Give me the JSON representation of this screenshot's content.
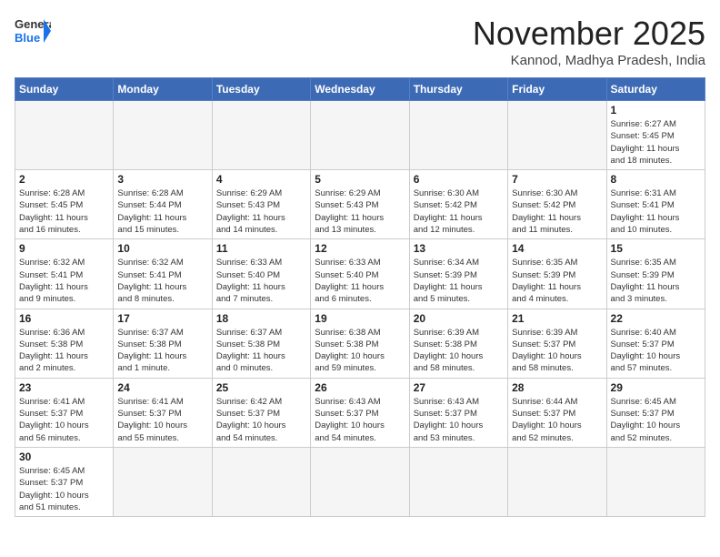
{
  "header": {
    "logo_general": "General",
    "logo_blue": "Blue",
    "month_title": "November 2025",
    "location": "Kannod, Madhya Pradesh, India"
  },
  "weekdays": [
    "Sunday",
    "Monday",
    "Tuesday",
    "Wednesday",
    "Thursday",
    "Friday",
    "Saturday"
  ],
  "weeks": [
    [
      {
        "day": "",
        "info": ""
      },
      {
        "day": "",
        "info": ""
      },
      {
        "day": "",
        "info": ""
      },
      {
        "day": "",
        "info": ""
      },
      {
        "day": "",
        "info": ""
      },
      {
        "day": "",
        "info": ""
      },
      {
        "day": "1",
        "info": "Sunrise: 6:27 AM\nSunset: 5:45 PM\nDaylight: 11 hours\nand 18 minutes."
      }
    ],
    [
      {
        "day": "2",
        "info": "Sunrise: 6:28 AM\nSunset: 5:45 PM\nDaylight: 11 hours\nand 16 minutes."
      },
      {
        "day": "3",
        "info": "Sunrise: 6:28 AM\nSunset: 5:44 PM\nDaylight: 11 hours\nand 15 minutes."
      },
      {
        "day": "4",
        "info": "Sunrise: 6:29 AM\nSunset: 5:43 PM\nDaylight: 11 hours\nand 14 minutes."
      },
      {
        "day": "5",
        "info": "Sunrise: 6:29 AM\nSunset: 5:43 PM\nDaylight: 11 hours\nand 13 minutes."
      },
      {
        "day": "6",
        "info": "Sunrise: 6:30 AM\nSunset: 5:42 PM\nDaylight: 11 hours\nand 12 minutes."
      },
      {
        "day": "7",
        "info": "Sunrise: 6:30 AM\nSunset: 5:42 PM\nDaylight: 11 hours\nand 11 minutes."
      },
      {
        "day": "8",
        "info": "Sunrise: 6:31 AM\nSunset: 5:41 PM\nDaylight: 11 hours\nand 10 minutes."
      }
    ],
    [
      {
        "day": "9",
        "info": "Sunrise: 6:32 AM\nSunset: 5:41 PM\nDaylight: 11 hours\nand 9 minutes."
      },
      {
        "day": "10",
        "info": "Sunrise: 6:32 AM\nSunset: 5:41 PM\nDaylight: 11 hours\nand 8 minutes."
      },
      {
        "day": "11",
        "info": "Sunrise: 6:33 AM\nSunset: 5:40 PM\nDaylight: 11 hours\nand 7 minutes."
      },
      {
        "day": "12",
        "info": "Sunrise: 6:33 AM\nSunset: 5:40 PM\nDaylight: 11 hours\nand 6 minutes."
      },
      {
        "day": "13",
        "info": "Sunrise: 6:34 AM\nSunset: 5:39 PM\nDaylight: 11 hours\nand 5 minutes."
      },
      {
        "day": "14",
        "info": "Sunrise: 6:35 AM\nSunset: 5:39 PM\nDaylight: 11 hours\nand 4 minutes."
      },
      {
        "day": "15",
        "info": "Sunrise: 6:35 AM\nSunset: 5:39 PM\nDaylight: 11 hours\nand 3 minutes."
      }
    ],
    [
      {
        "day": "16",
        "info": "Sunrise: 6:36 AM\nSunset: 5:38 PM\nDaylight: 11 hours\nand 2 minutes."
      },
      {
        "day": "17",
        "info": "Sunrise: 6:37 AM\nSunset: 5:38 PM\nDaylight: 11 hours\nand 1 minute."
      },
      {
        "day": "18",
        "info": "Sunrise: 6:37 AM\nSunset: 5:38 PM\nDaylight: 11 hours\nand 0 minutes."
      },
      {
        "day": "19",
        "info": "Sunrise: 6:38 AM\nSunset: 5:38 PM\nDaylight: 10 hours\nand 59 minutes."
      },
      {
        "day": "20",
        "info": "Sunrise: 6:39 AM\nSunset: 5:38 PM\nDaylight: 10 hours\nand 58 minutes."
      },
      {
        "day": "21",
        "info": "Sunrise: 6:39 AM\nSunset: 5:37 PM\nDaylight: 10 hours\nand 58 minutes."
      },
      {
        "day": "22",
        "info": "Sunrise: 6:40 AM\nSunset: 5:37 PM\nDaylight: 10 hours\nand 57 minutes."
      }
    ],
    [
      {
        "day": "23",
        "info": "Sunrise: 6:41 AM\nSunset: 5:37 PM\nDaylight: 10 hours\nand 56 minutes."
      },
      {
        "day": "24",
        "info": "Sunrise: 6:41 AM\nSunset: 5:37 PM\nDaylight: 10 hours\nand 55 minutes."
      },
      {
        "day": "25",
        "info": "Sunrise: 6:42 AM\nSunset: 5:37 PM\nDaylight: 10 hours\nand 54 minutes."
      },
      {
        "day": "26",
        "info": "Sunrise: 6:43 AM\nSunset: 5:37 PM\nDaylight: 10 hours\nand 54 minutes."
      },
      {
        "day": "27",
        "info": "Sunrise: 6:43 AM\nSunset: 5:37 PM\nDaylight: 10 hours\nand 53 minutes."
      },
      {
        "day": "28",
        "info": "Sunrise: 6:44 AM\nSunset: 5:37 PM\nDaylight: 10 hours\nand 52 minutes."
      },
      {
        "day": "29",
        "info": "Sunrise: 6:45 AM\nSunset: 5:37 PM\nDaylight: 10 hours\nand 52 minutes."
      }
    ],
    [
      {
        "day": "30",
        "info": "Sunrise: 6:45 AM\nSunset: 5:37 PM\nDaylight: 10 hours\nand 51 minutes."
      },
      {
        "day": "",
        "info": ""
      },
      {
        "day": "",
        "info": ""
      },
      {
        "day": "",
        "info": ""
      },
      {
        "day": "",
        "info": ""
      },
      {
        "day": "",
        "info": ""
      },
      {
        "day": "",
        "info": ""
      }
    ]
  ]
}
